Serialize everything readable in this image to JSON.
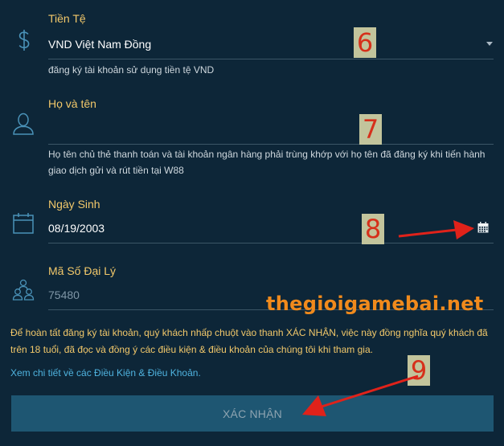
{
  "currency": {
    "label": "Tiền Tệ",
    "value": "VND Việt Nam Đồng",
    "help": "đăng ký tài khoản sử dụng tiền tệ VND",
    "badge": "6"
  },
  "full_name": {
    "label": "Họ và tên",
    "value": "",
    "help": "Họ tên chủ thẻ thanh toán và tài khoản ngân hàng phải trùng khớp với họ tên đã đăng ký khi tiến hành giao dịch gửi và rút tiền tại W88",
    "badge": "7"
  },
  "birth_date": {
    "label": "Ngày Sinh",
    "value": "08/19/2003",
    "badge": "8"
  },
  "agent_code": {
    "label": "Mã Số Đại Lý",
    "value": "75480"
  },
  "watermark": "thegioigamebai.net",
  "terms": {
    "text": "Để hoàn tất đăng ký tài khoản, quý khách nhấp chuột vào thanh XÁC NHẬN, việc này đồng nghĩa quý khách đã trên 18 tuổi, đã đọc và đồng ý các điều kiện & điều khoản của chúng tôi khi tham gia.",
    "link": "Xem chi tiết về các Điều Kiện & Điều Khoản."
  },
  "confirm": {
    "label": "XÁC NHẬN",
    "badge": "9"
  },
  "colors": {
    "background": "#0d2638",
    "label": "#f2c86a",
    "link": "#4fb3df",
    "button": "#1e5672",
    "annotation": "#e0221a"
  },
  "icons": [
    "dollar-icon",
    "user-icon",
    "calendar-icon",
    "group-icon",
    "chevron-down-icon"
  ]
}
